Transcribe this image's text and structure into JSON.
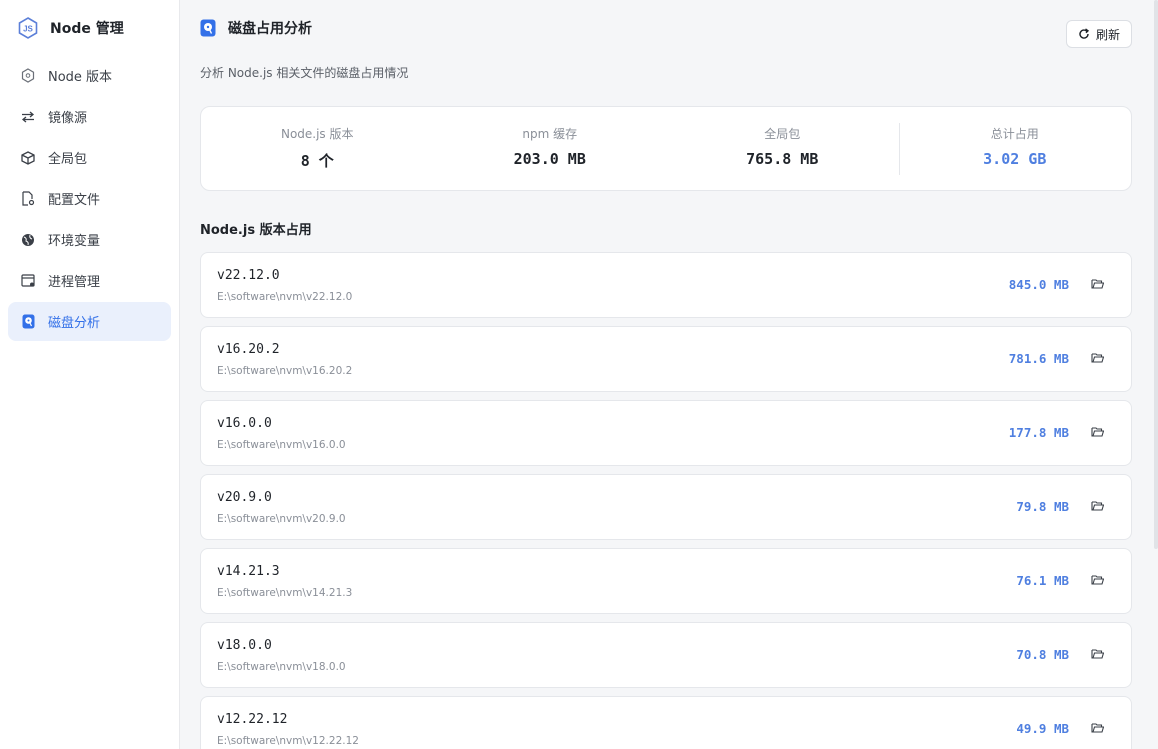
{
  "app": {
    "title": "Node 管理"
  },
  "sidebar": {
    "items": [
      {
        "label": "Node 版本",
        "icon": "node-hex-icon",
        "active": false
      },
      {
        "label": "镜像源",
        "icon": "swap-arrows-icon",
        "active": false
      },
      {
        "label": "全局包",
        "icon": "package-box-icon",
        "active": false
      },
      {
        "label": "配置文件",
        "icon": "config-file-icon",
        "active": false
      },
      {
        "label": "环境变量",
        "icon": "globe-icon",
        "active": false
      },
      {
        "label": "进程管理",
        "icon": "process-window-icon",
        "active": false
      },
      {
        "label": "磁盘分析",
        "icon": "disk-icon",
        "active": true
      }
    ]
  },
  "header": {
    "title": "磁盘占用分析",
    "subtitle": "分析 Node.js 相关文件的磁盘占用情况",
    "refresh_label": "刷新"
  },
  "stats": {
    "node_versions": {
      "label": "Node.js 版本",
      "value": "8 个"
    },
    "npm_cache": {
      "label": "npm 缓存",
      "value": "203.0 MB"
    },
    "global_packages": {
      "label": "全局包",
      "value": "765.8 MB"
    },
    "total": {
      "label": "总计占用",
      "value": "3.02 GB"
    }
  },
  "section": {
    "title": "Node.js 版本占用"
  },
  "versions": [
    {
      "name": "v22.12.0",
      "path": "E:\\software\\nvm\\v22.12.0",
      "size": "845.0 MB"
    },
    {
      "name": "v16.20.2",
      "path": "E:\\software\\nvm\\v16.20.2",
      "size": "781.6 MB"
    },
    {
      "name": "v16.0.0",
      "path": "E:\\software\\nvm\\v16.0.0",
      "size": "177.8 MB"
    },
    {
      "name": "v20.9.0",
      "path": "E:\\software\\nvm\\v20.9.0",
      "size": "79.8 MB"
    },
    {
      "name": "v14.21.3",
      "path": "E:\\software\\nvm\\v14.21.3",
      "size": "76.1 MB"
    },
    {
      "name": "v18.0.0",
      "path": "E:\\software\\nvm\\v18.0.0",
      "size": "70.8 MB"
    },
    {
      "name": "v12.22.12",
      "path": "E:\\software\\nvm\\v12.22.12",
      "size": "49.9 MB"
    }
  ],
  "colors": {
    "accent": "#4f7fe0",
    "active_bg": "#eaf0fc"
  }
}
